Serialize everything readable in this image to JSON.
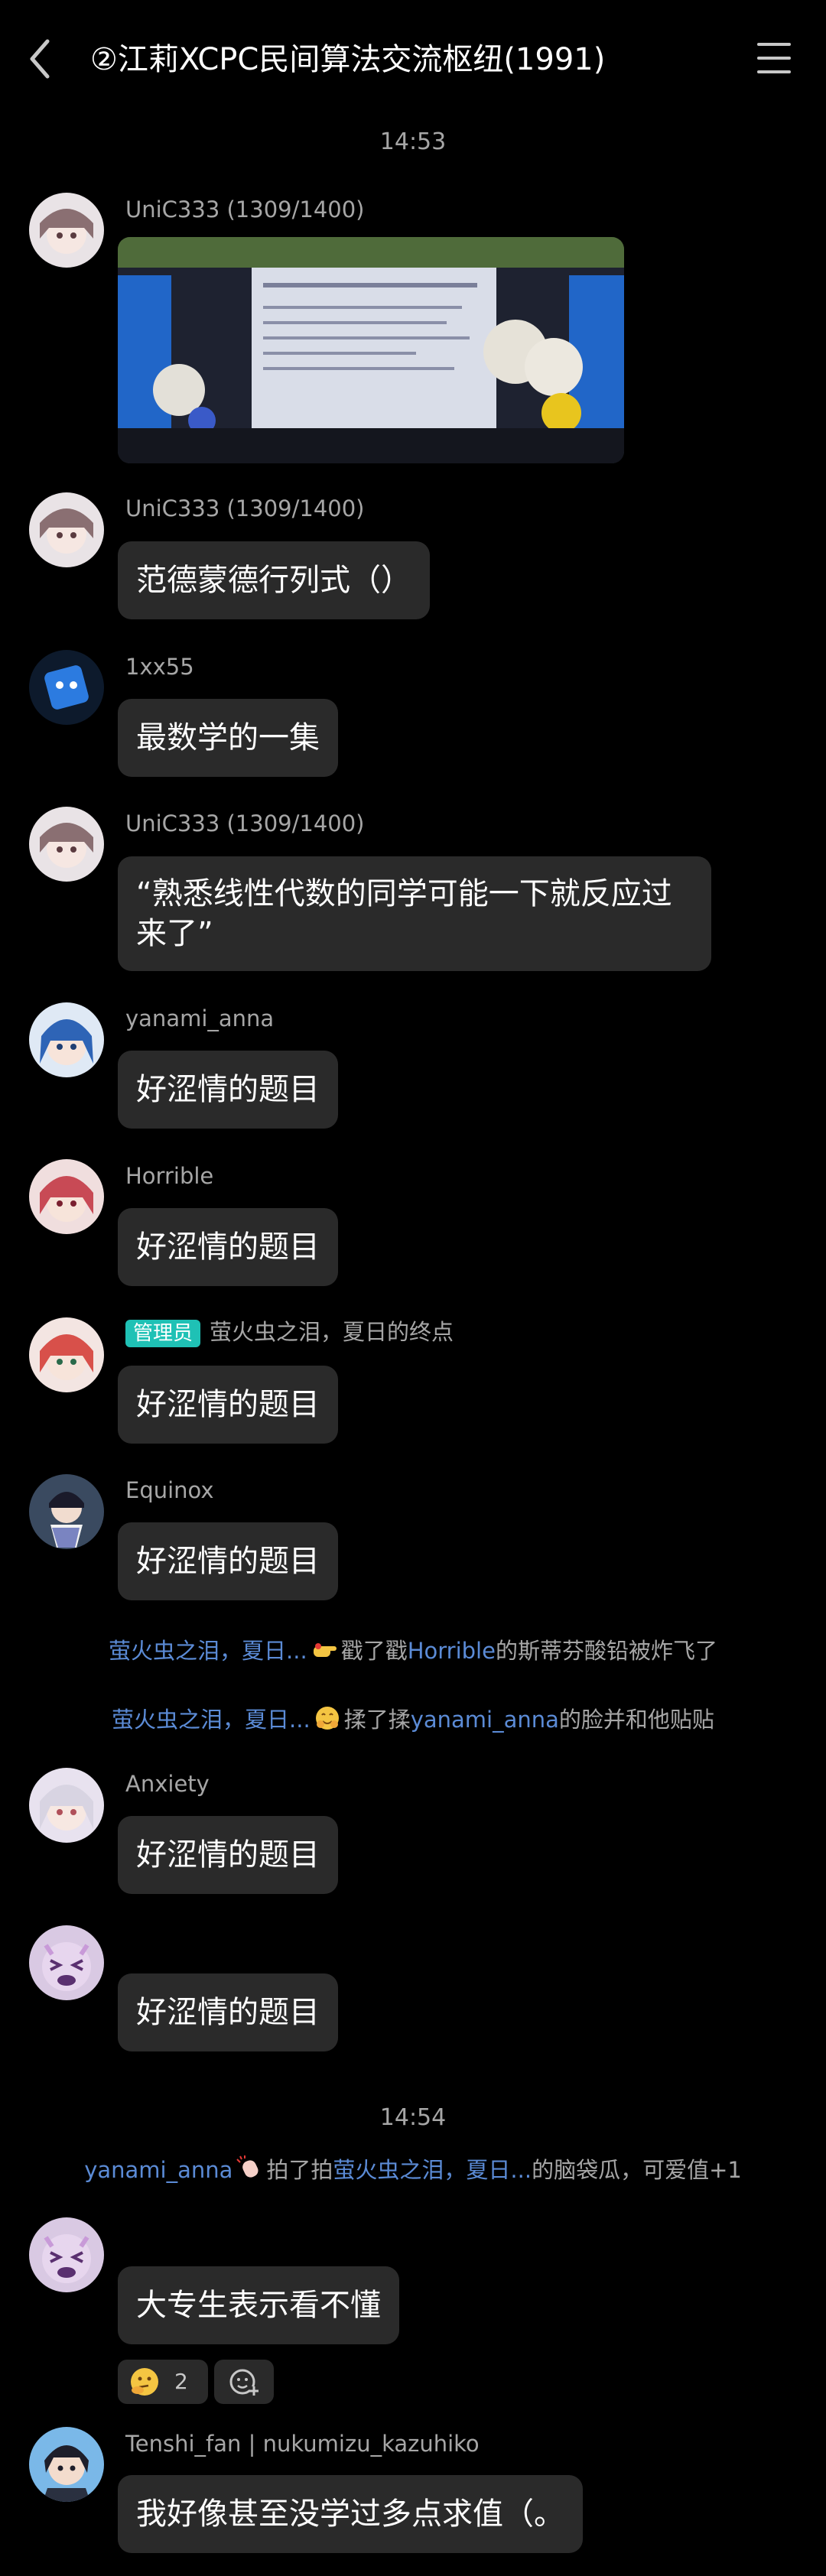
{
  "header": {
    "title": "②江莉XCPC民间算法交流枢纽(1991)"
  },
  "timestamps": [
    "14:53",
    "14:54"
  ],
  "messages": [
    {
      "sender": "UniC333 (1309/1400)",
      "type": "image"
    },
    {
      "sender": "UniC333 (1309/1400)",
      "text": "范德蒙德行列式（）"
    },
    {
      "sender": "1xx55",
      "text": "最数学的一集"
    },
    {
      "sender": "UniC333 (1309/1400)",
      "text": "“熟悉线性代数的同学可能一下就反应过来了”"
    },
    {
      "sender": "yanami_anna",
      "text": "好涩情的题目"
    },
    {
      "sender": "Horrible",
      "text": "好涩情的题目"
    },
    {
      "sender": "萤火虫之泪，夏日的终点",
      "badge": "管理员",
      "text": "好涩情的题目"
    },
    {
      "sender": "Equinox",
      "text": "好涩情的题目"
    },
    {
      "sender": "Anxiety",
      "text": "好涩情的题目"
    },
    {
      "sender": "",
      "text": "好涩情的题目"
    },
    {
      "sender": "",
      "text": "大专生表示看不懂",
      "reaction_count": "2"
    },
    {
      "sender": "Tenshi_fan | nukumizu_kazuhiko",
      "text": "我好像甚至没学过多点求值（。"
    }
  ],
  "system": [
    {
      "actor": "萤火虫之泪，夏日...",
      "verb": "戳了戳",
      "target": "Horrible",
      "rest": "的斯蒂芬酸铅被炸飞了"
    },
    {
      "actor": "萤火虫之泪，夏日...",
      "verb": "揉了揉",
      "target": "yanami_anna",
      "rest": "的脸并和他贴贴"
    },
    {
      "actor": "yanami_anna",
      "verb": "拍了拍",
      "target": "萤火虫之泪，夏日...",
      "rest": "的脑袋瓜，可爱值+1"
    }
  ],
  "icons": [
    "back-arrow-icon",
    "menu-icon",
    "pointing-hand-icon",
    "hug-face-icon",
    "clapping-hand-icon",
    "thinking-face-icon",
    "add-reaction-icon"
  ],
  "colors": {
    "background": "#000000",
    "bubble": "#2a2a2a",
    "highlight_link": "#5b8bd6",
    "admin_badge": "#1fc1b5",
    "muted_text": "#a6a6a6"
  }
}
